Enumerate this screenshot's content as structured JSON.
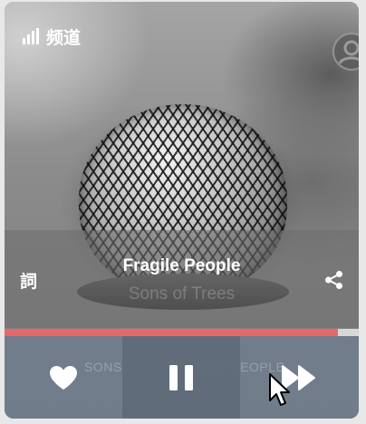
{
  "header": {
    "channel_label": "频道",
    "channel_icon": "signal-bars-icon",
    "avatar_icon": "user-avatar-icon"
  },
  "song": {
    "lyrics_label": "詞",
    "title": "Fragile People",
    "artist": "Sons of Trees",
    "share_icon": "share-icon"
  },
  "progress": {
    "fraction": 0.94
  },
  "controls": {
    "like_icon": "heart-icon",
    "pause_icon": "pause-icon",
    "next_icon": "fast-forward-icon",
    "ghost_left": "SONS",
    "ghost_right": "GILE PEOPLE"
  },
  "colors": {
    "progress_fill": "#e8686a",
    "progress_track": "#d8d8d8",
    "controls_bg": "#6e7d8c"
  }
}
